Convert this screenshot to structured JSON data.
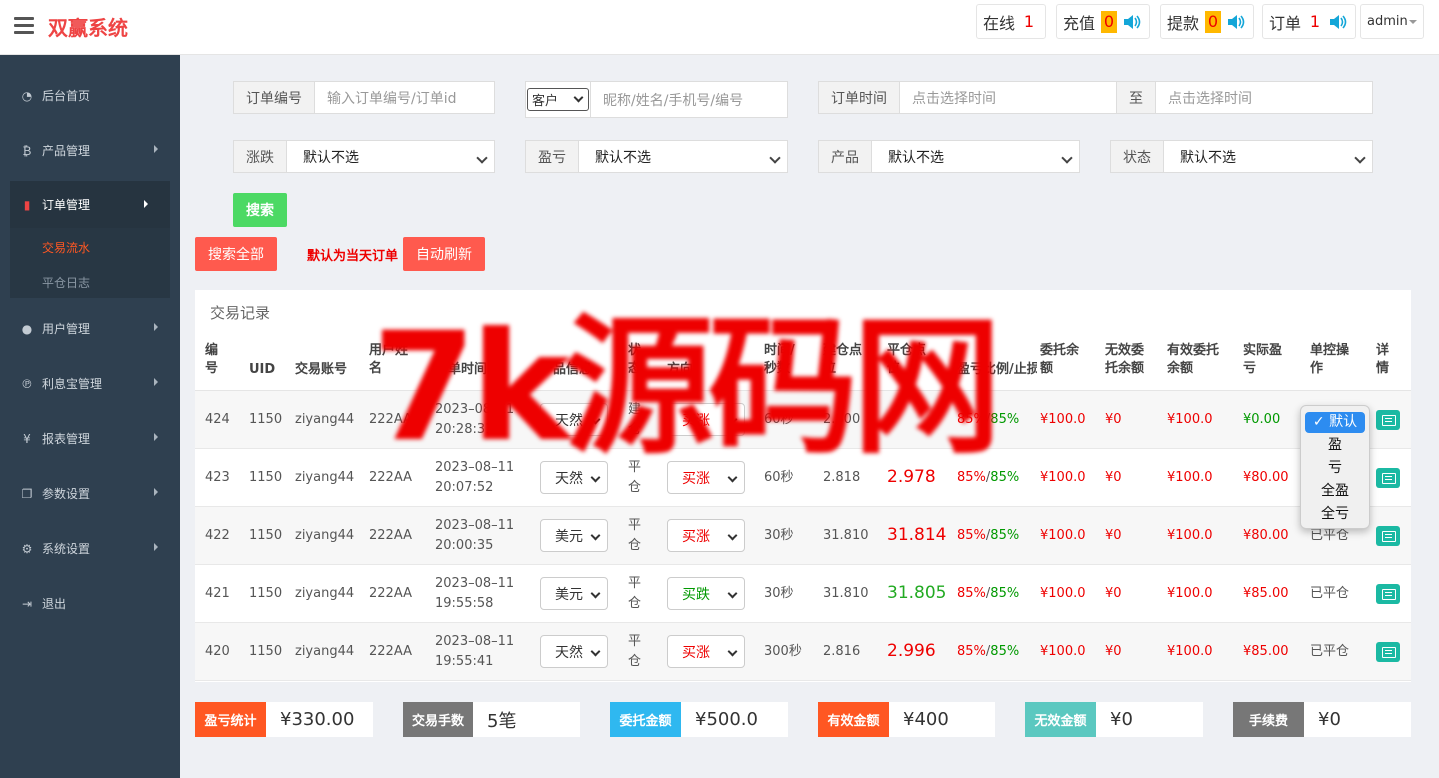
{
  "app": {
    "title": "双赢系统"
  },
  "header": {
    "stats": [
      {
        "label": "在线",
        "count": "1"
      },
      {
        "label": "充值",
        "count": "0"
      },
      {
        "label": "提款",
        "count": "0"
      },
      {
        "label": "订单",
        "count": "1"
      }
    ],
    "user": "admin"
  },
  "sidebar": {
    "items": [
      {
        "label": "后台首页",
        "icon": "dashboard-icon"
      },
      {
        "label": "产品管理",
        "icon": "bitcoin-icon"
      },
      {
        "label": "订单管理",
        "icon": "order-icon"
      },
      {
        "label": "用户管理",
        "icon": "user-icon"
      },
      {
        "label": "利息宝管理",
        "icon": "interest-icon"
      },
      {
        "label": "报表管理",
        "icon": "yen-icon"
      },
      {
        "label": "参数设置",
        "icon": "params-icon"
      },
      {
        "label": "系统设置",
        "icon": "gears-icon"
      },
      {
        "label": "退出",
        "icon": "logout-icon"
      }
    ],
    "sub_items": [
      {
        "label": "交易流水"
      },
      {
        "label": "平仓日志"
      }
    ]
  },
  "filters": {
    "order_no_label": "订单编号",
    "order_no_placeholder": "输入订单编号/订单id",
    "customer_select": "客户",
    "customer_placeholder": "昵称/姓名/手机号/编号",
    "time_label": "订单时间",
    "time_start_placeholder": "点击选择时间",
    "time_to": "至",
    "time_end_placeholder": "点击选择时间",
    "rise_fall_label": "涨跌",
    "profit_label": "盈亏",
    "product_label": "产品",
    "status_label": "状态",
    "default_option": "默认不选",
    "search_button": "搜索"
  },
  "actions": {
    "search_all": "搜索全部",
    "default_note": "默认为当天订单",
    "auto_refresh": "自动刷新"
  },
  "table": {
    "title": "交易记录",
    "columns": [
      "编号",
      "UID",
      "交易账号",
      "用户姓名",
      "订单时间",
      "产品信息",
      "状态",
      "方向",
      "时间/秒数",
      "建仓点位",
      "平仓点位",
      "盈亏比例/止损",
      "委托余额",
      "无效委托余额",
      "有效委托余额",
      "实际盈亏",
      "单控操作",
      "详情"
    ],
    "rows": [
      {
        "id": "424",
        "uid": "1150",
        "account": "ziyang44",
        "name": "222AA",
        "date": "2023–08–11",
        "time": "20:28:31",
        "product": "天然",
        "status1": "建",
        "status2": "仓",
        "direction": "买涨",
        "dir_color": "#e00",
        "seconds": "60秒",
        "open": "2.800",
        "close": "",
        "close_color": "#e00",
        "ratio1": "85%",
        "ratio2": "85%",
        "entrust": "¥100.0",
        "invalid": "¥0",
        "valid": "¥100.0",
        "profit": "¥0.00",
        "profit_color": "#090",
        "control": ""
      },
      {
        "id": "423",
        "uid": "1150",
        "account": "ziyang44",
        "name": "222AA",
        "date": "2023–08–11",
        "time": "20:07:52",
        "product": "天然",
        "status1": "平",
        "status2": "仓",
        "direction": "买涨",
        "dir_color": "#e00",
        "seconds": "60秒",
        "open": "2.818",
        "close": "2.978",
        "close_color": "#e00",
        "ratio1": "85%",
        "ratio2": "85%",
        "entrust": "¥100.0",
        "invalid": "¥0",
        "valid": "¥100.0",
        "profit": "¥80.00",
        "profit_color": "#e00",
        "control": ""
      },
      {
        "id": "422",
        "uid": "1150",
        "account": "ziyang44",
        "name": "222AA",
        "date": "2023–08–11",
        "time": "20:00:35",
        "product": "美元",
        "status1": "平",
        "status2": "仓",
        "direction": "买涨",
        "dir_color": "#e00",
        "seconds": "30秒",
        "open": "31.810",
        "close": "31.814",
        "close_color": "#e00",
        "ratio1": "85%",
        "ratio2": "85%",
        "entrust": "¥100.0",
        "invalid": "¥0",
        "valid": "¥100.0",
        "profit": "¥80.00",
        "profit_color": "#e00",
        "control": "已平仓"
      },
      {
        "id": "421",
        "uid": "1150",
        "account": "ziyang44",
        "name": "222AA",
        "date": "2023–08–11",
        "time": "19:55:58",
        "product": "美元",
        "status1": "平",
        "status2": "仓",
        "direction": "买跌",
        "dir_color": "#090",
        "seconds": "30秒",
        "open": "31.810",
        "close": "31.805",
        "close_color": "#2a2",
        "ratio1": "85%",
        "ratio2": "85%",
        "entrust": "¥100.0",
        "invalid": "¥0",
        "valid": "¥100.0",
        "profit": "¥85.00",
        "profit_color": "#e00",
        "control": "已平仓"
      },
      {
        "id": "420",
        "uid": "1150",
        "account": "ziyang44",
        "name": "222AA",
        "date": "2023–08–11",
        "time": "19:55:41",
        "product": "天然",
        "status1": "平",
        "status2": "仓",
        "direction": "买涨",
        "dir_color": "#e00",
        "seconds": "300秒",
        "open": "2.816",
        "close": "2.996",
        "close_color": "#e00",
        "ratio1": "85%",
        "ratio2": "85%",
        "entrust": "¥100.0",
        "invalid": "¥0",
        "valid": "¥100.0",
        "profit": "¥85.00",
        "profit_color": "#e00",
        "control": "已平仓"
      }
    ]
  },
  "control_dropdown": {
    "options": [
      "✓ 默认",
      "盈",
      "亏",
      "全盈",
      "全亏"
    ],
    "selected": "✓ 默认"
  },
  "summary": [
    {
      "label": "盈亏统计",
      "value": "¥330.00",
      "color": "#ff5722"
    },
    {
      "label": "交易手数",
      "value": "5笔",
      "color": "#777777"
    },
    {
      "label": "委托金额",
      "value": "¥500.0",
      "color": "#2fb8f0"
    },
    {
      "label": "有效金额",
      "value": "¥400",
      "color": "#ff5722"
    },
    {
      "label": "无效金额",
      "value": "¥0",
      "color": "#5bc8c0"
    },
    {
      "label": "手续费",
      "value": "¥0",
      "color": "#777777"
    }
  ],
  "watermark": "7k源码网"
}
